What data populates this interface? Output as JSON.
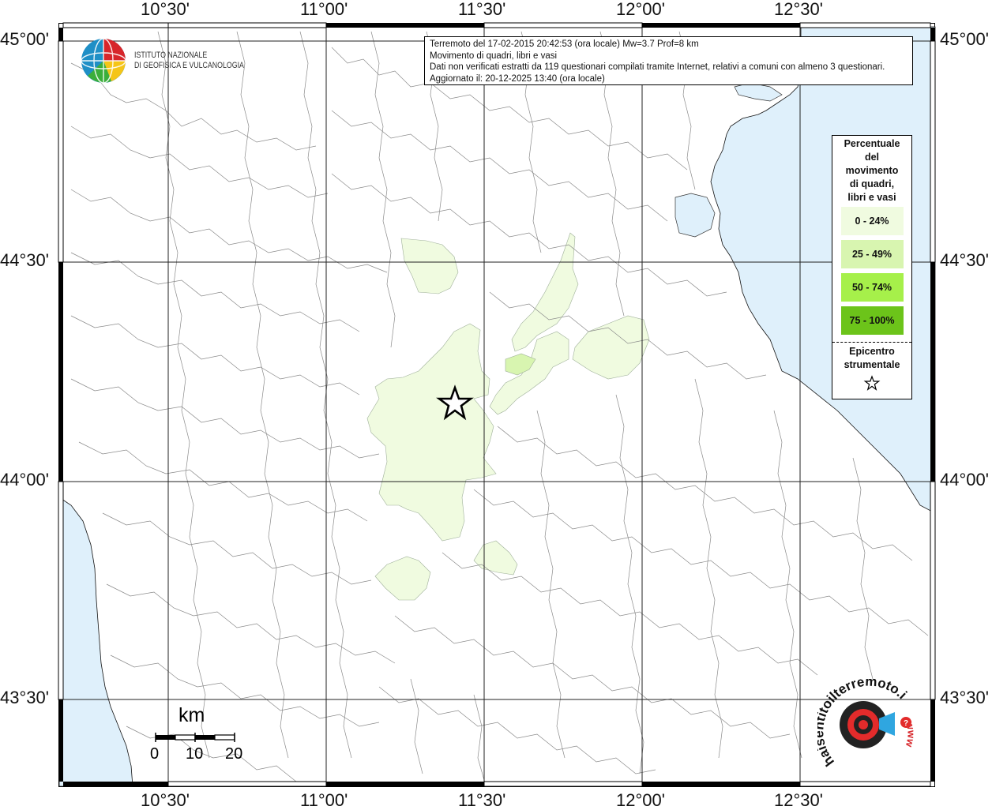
{
  "map": {
    "longitude_labels": [
      "10°30'",
      "11°00'",
      "11°30'",
      "12°00'",
      "12°30'"
    ],
    "latitude_labels": [
      "45°00'",
      "44°30'",
      "44°00'",
      "43°30'"
    ],
    "sea_color": "#dff0fb",
    "land_color": "#ffffff"
  },
  "info": {
    "line1": "Terremoto del 17-02-2015 20:42:53 (ora locale) Mw=3.7 Prof=8 km",
    "line2": "Movimento di quadri, libri e vasi",
    "line3": "Dati non verificati estratti da 119 questionari compilati tramite Internet, relativi a comuni con almeno 3 questionari.",
    "line4": "Aggiornato il: 20-12-2025 13:40 (ora locale)"
  },
  "ingv": {
    "line1": "ISTITUTO NAZIONALE",
    "line2": "DI GEOFISICA E VULCANOLOGIA"
  },
  "legend": {
    "title": [
      "Percentuale",
      "del",
      "movimento",
      "di quadri,",
      "libri e vasi"
    ],
    "items": [
      {
        "label": "0 - 24%",
        "color": "#f0fbe0"
      },
      {
        "label": "25 - 49%",
        "color": "#d8f5b0"
      },
      {
        "label": "50 - 74%",
        "color": "#a6f04a"
      },
      {
        "label": "75 - 100%",
        "color": "#6cc41a"
      }
    ],
    "epicenter_title": [
      "Epicentro",
      "strumentale"
    ]
  },
  "scale": {
    "unit": "km",
    "ticks": [
      "0",
      "10",
      "20"
    ]
  },
  "hsit": {
    "brand": "haisentitoilterremoto.it",
    "url": "www"
  }
}
